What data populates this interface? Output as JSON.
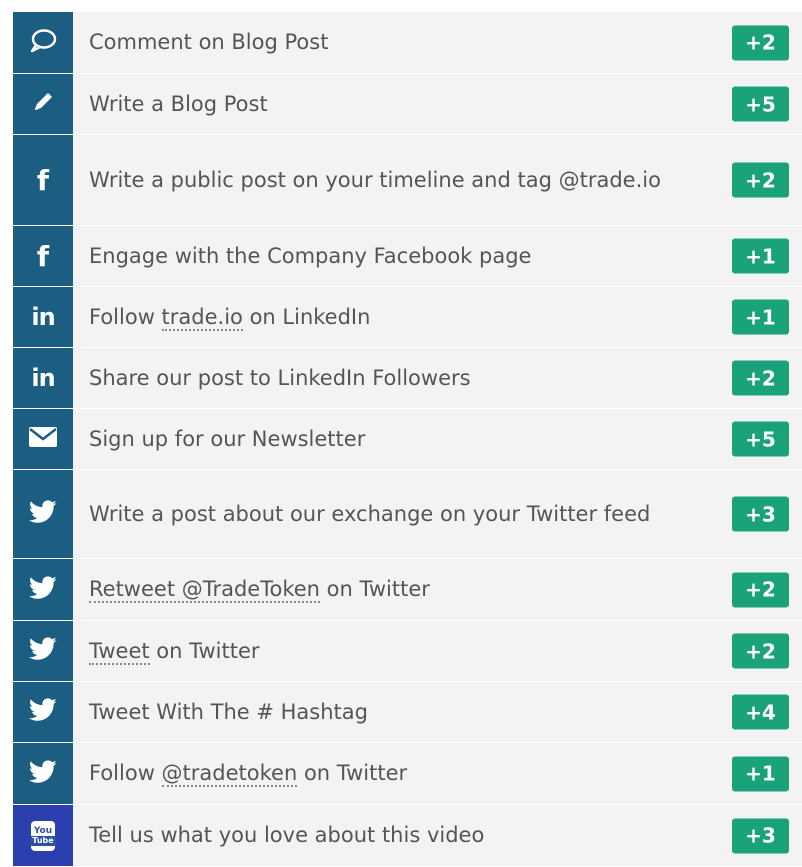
{
  "colors": {
    "icon_bg_default": "#1b5e82",
    "icon_bg_youtube": "#2b3fae",
    "badge_bg": "#1aa37a",
    "row_bg": "#f3f3f3",
    "text": "#555555"
  },
  "tasks": [
    {
      "icon": "speech-bubble-icon",
      "parts": [
        {
          "text": "Comment on Blog Post",
          "link": false
        }
      ],
      "points": "+2"
    },
    {
      "icon": "pencil-icon",
      "parts": [
        {
          "text": "Write a Blog Post",
          "link": false
        }
      ],
      "points": "+5"
    },
    {
      "icon": "facebook-icon",
      "parts": [
        {
          "text": "Write a public post on your timeline and tag @trade.io",
          "link": false
        }
      ],
      "points": "+2"
    },
    {
      "icon": "facebook-icon",
      "parts": [
        {
          "text": "Engage with the Company Facebook page",
          "link": false
        }
      ],
      "points": "+1"
    },
    {
      "icon": "linkedin-icon",
      "parts": [
        {
          "text": "Follow ",
          "link": false
        },
        {
          "text": "trade.io",
          "link": true
        },
        {
          "text": " on LinkedIn",
          "link": false
        }
      ],
      "points": "+1"
    },
    {
      "icon": "linkedin-icon",
      "parts": [
        {
          "text": "Share our post to LinkedIn Followers",
          "link": false
        }
      ],
      "points": "+2"
    },
    {
      "icon": "envelope-icon",
      "parts": [
        {
          "text": "Sign up for our Newsletter",
          "link": false
        }
      ],
      "points": "+5"
    },
    {
      "icon": "twitter-icon",
      "parts": [
        {
          "text": "Write a post about our exchange on your Twitter feed",
          "link": false
        }
      ],
      "points": "+3"
    },
    {
      "icon": "twitter-icon",
      "parts": [
        {
          "text": "Retweet @TradeToken",
          "link": true
        },
        {
          "text": " on Twitter",
          "link": false
        }
      ],
      "points": "+2"
    },
    {
      "icon": "twitter-icon",
      "parts": [
        {
          "text": "Tweet",
          "link": true
        },
        {
          "text": " on Twitter",
          "link": false
        }
      ],
      "points": "+2"
    },
    {
      "icon": "twitter-icon",
      "parts": [
        {
          "text": "Tweet With The # Hashtag",
          "link": false
        }
      ],
      "points": "+4"
    },
    {
      "icon": "twitter-icon",
      "parts": [
        {
          "text": "Follow ",
          "link": false
        },
        {
          "text": "@tradetoken",
          "link": true
        },
        {
          "text": " on Twitter",
          "link": false
        }
      ],
      "points": "+1"
    },
    {
      "icon": "youtube-icon",
      "parts": [
        {
          "text": "Tell us what you love about this video",
          "link": false
        }
      ],
      "points": "+3"
    }
  ]
}
